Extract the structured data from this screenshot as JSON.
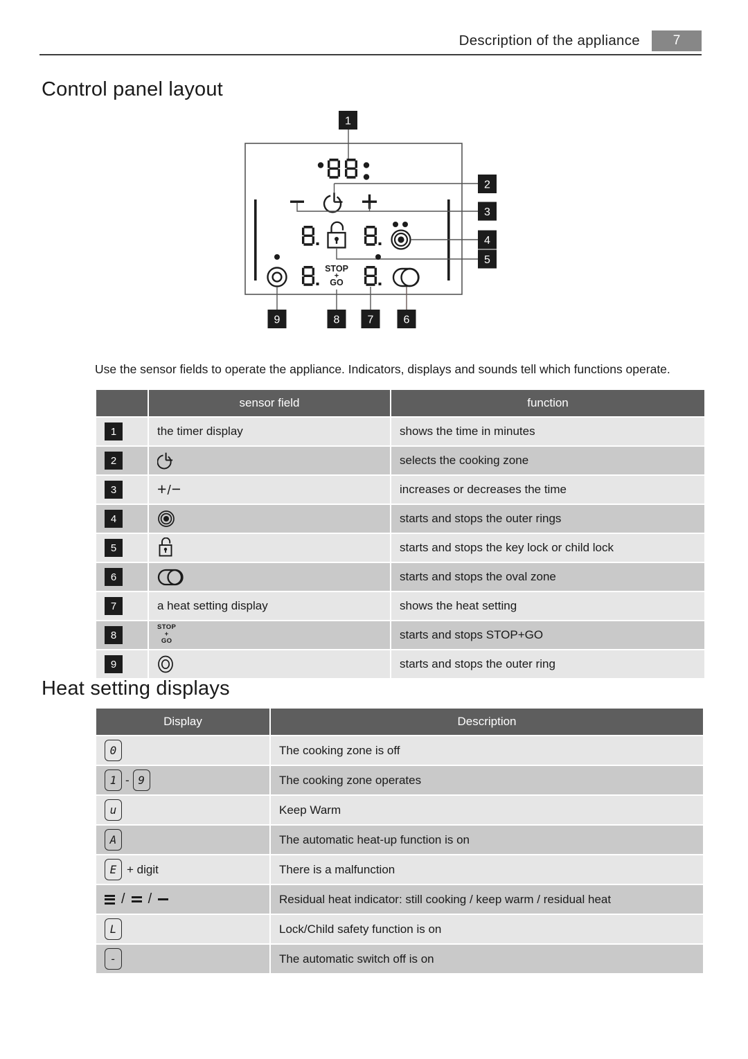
{
  "header": {
    "title": "Description of the appliance",
    "page_number": "7"
  },
  "sections": {
    "control_panel_heading": "Control panel layout",
    "heat_setting_heading": "Heat setting displays",
    "intro_paragraph": "Use the sensor fields to operate the appliance. Indicators, displays and sounds tell which functions operate."
  },
  "diagram": {
    "callouts": [
      "1",
      "2",
      "3",
      "4",
      "5",
      "6",
      "7",
      "8",
      "9"
    ],
    "timer_digits": "88",
    "minus_label": "−",
    "plus_label": "+",
    "stop_go_line1": "STOP",
    "stop_go_line2": "+",
    "stop_go_line3": "GO",
    "heat_digits": [
      "8.",
      "8.",
      "8.",
      "8."
    ]
  },
  "sensor_table": {
    "columns": [
      "",
      "sensor field",
      "function"
    ],
    "rows": [
      {
        "num": "1",
        "sensor_text": "the timer display",
        "sensor_icon": "",
        "function": "shows the time in minutes"
      },
      {
        "num": "2",
        "sensor_text": "",
        "sensor_icon": "timer-icon",
        "function": "selects the cooking zone"
      },
      {
        "num": "3",
        "sensor_text": "",
        "sensor_icon": "plus-minus-icon",
        "function": "increases or decreases the time"
      },
      {
        "num": "4",
        "sensor_text": "",
        "sensor_icon": "outer-rings-icon",
        "function": "starts and stops the outer rings"
      },
      {
        "num": "5",
        "sensor_text": "",
        "sensor_icon": "lock-icon",
        "function": "starts and stops the key lock or child lock"
      },
      {
        "num": "6",
        "sensor_text": "",
        "sensor_icon": "oval-zone-icon",
        "function": "starts and stops the oval zone"
      },
      {
        "num": "7",
        "sensor_text": "a heat setting display",
        "sensor_icon": "",
        "function": "shows the heat setting"
      },
      {
        "num": "8",
        "sensor_text": "",
        "sensor_icon": "stop-go-icon",
        "function": "starts and stops STOP+GO"
      },
      {
        "num": "9",
        "sensor_text": "",
        "sensor_icon": "outer-ring-icon",
        "function": "starts and stops the outer ring"
      }
    ],
    "plus_minus_label": "+",
    "plus_minus_slash": "/",
    "plus_minus_minus": "−",
    "stop_go": {
      "line1": "STOP",
      "line2": "+",
      "line3": "GO"
    }
  },
  "heat_table": {
    "columns": [
      "Display",
      "Description"
    ],
    "rows": [
      {
        "display_glyphs": [
          "0"
        ],
        "suffix": "",
        "description": "The cooking zone is off"
      },
      {
        "display_glyphs": [
          "1",
          "9"
        ],
        "separator": "-",
        "suffix": "",
        "description": "The cooking zone operates"
      },
      {
        "display_glyphs": [
          "u"
        ],
        "suffix": "",
        "description": "Keep Warm"
      },
      {
        "display_glyphs": [
          "A"
        ],
        "suffix": "",
        "description": "The automatic heat-up function is on"
      },
      {
        "display_glyphs": [
          "E"
        ],
        "suffix": "+ digit",
        "description": "There is a malfunction"
      },
      {
        "display_glyphs": [],
        "bars": [
          3,
          2,
          1
        ],
        "bar_separator": "/",
        "suffix": "",
        "description": "Residual heat indicator: still cooking / keep warm / residual heat"
      },
      {
        "display_glyphs": [
          "L"
        ],
        "suffix": "",
        "description": "Lock/Child safety function is on"
      },
      {
        "display_glyphs": [
          "-"
        ],
        "suffix": "",
        "description": "The automatic switch off is on"
      }
    ]
  },
  "colors": {
    "header_badge": "#878787",
    "table_header": "#5e5e5e",
    "row_light": "#e6e6e6",
    "row_dark": "#c9c9c9",
    "badge_black": "#1c1c1c",
    "ink": "#1a1a1a"
  }
}
